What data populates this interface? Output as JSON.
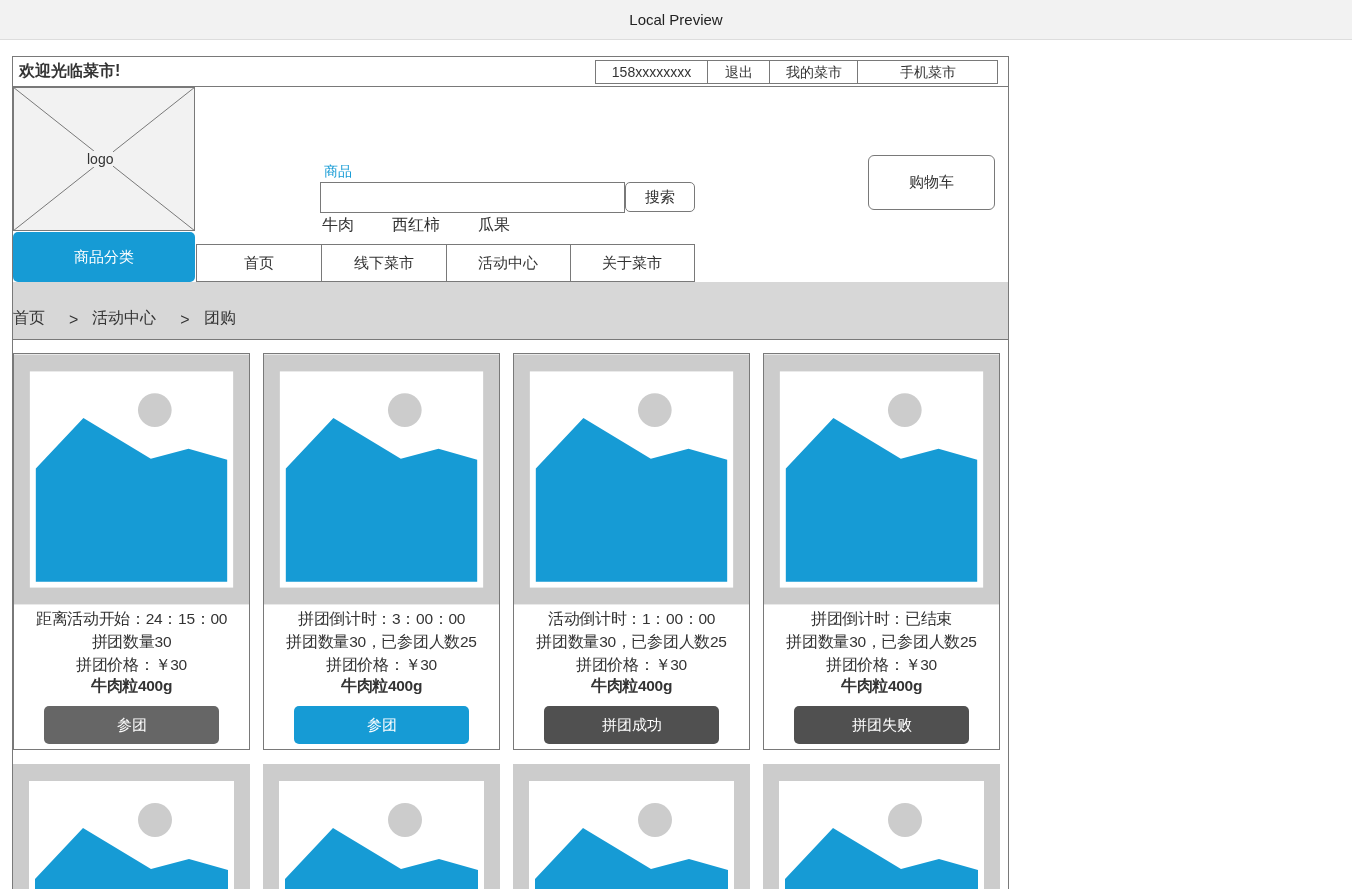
{
  "window": {
    "title": "Local Preview"
  },
  "top_bar": {
    "welcome": "欢迎光临菜市!",
    "links": [
      "158xxxxxxxx",
      "退出",
      "我的菜市",
      "手机菜市"
    ]
  },
  "logo": {
    "label": "logo"
  },
  "search": {
    "label": "商品",
    "button": "搜索",
    "hot_words": [
      "牛肉",
      "西红柿",
      "瓜果"
    ]
  },
  "cart_button": "购物车",
  "category_button": "商品分类",
  "nav_tabs": [
    "首页",
    "线下菜市",
    "活动中心",
    "关于菜市"
  ],
  "breadcrumb": [
    {
      "kind": "link",
      "text": "首页"
    },
    {
      "kind": "separator",
      "text": ">"
    },
    {
      "kind": "link",
      "text": "活动中心"
    },
    {
      "kind": "separator",
      "text": ">"
    },
    {
      "kind": "current",
      "text": "团购"
    }
  ],
  "products": [
    {
      "countdown": "距离活动开始：24：15：00",
      "group_info": "拼团数量30",
      "price": "拼团价格：￥30",
      "name": "牛肉粒400g",
      "button": {
        "label": "参团",
        "kind": "disabled"
      }
    },
    {
      "countdown": "拼团倒计时：3：00：00",
      "group_info": "拼团数量30，已参团人数25",
      "price": "拼团价格：￥30",
      "name": "牛肉粒400g",
      "button": {
        "label": "参团",
        "kind": "active"
      }
    },
    {
      "countdown": "活动倒计时：1：00：00",
      "group_info": "拼团数量30，已参团人数25",
      "price": "拼团价格：￥30",
      "name": "牛肉粒400g",
      "button": {
        "label": "拼团成功",
        "kind": "done"
      }
    },
    {
      "countdown": "拼团倒计时：已结束",
      "group_info": "拼团数量30，已参团人数25",
      "price": "拼团价格：￥30",
      "name": "牛肉粒400g",
      "button": {
        "label": "拼团失败",
        "kind": "done"
      }
    }
  ],
  "more_products": [
    {
      "kind": "picture"
    },
    {
      "kind": "picture"
    },
    {
      "kind": "picture"
    },
    {
      "kind": "picture"
    }
  ]
}
